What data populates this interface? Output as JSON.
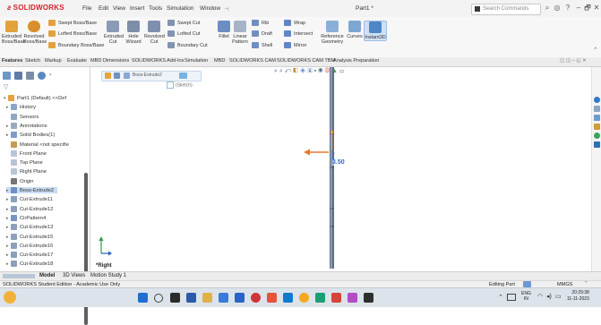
{
  "app": {
    "logo_text": "SOLIDWORKS",
    "doc_title": "Part1 *"
  },
  "menu": [
    "File",
    "Edit",
    "View",
    "Insert",
    "Tools",
    "Simulation",
    "Window"
  ],
  "search": {
    "placeholder": "Search Commands"
  },
  "window_controls": {
    "minimize": "–",
    "restore": "🗗",
    "close": "✕"
  },
  "ribbon": {
    "extruded_boss": "Extruded Boss/Base",
    "revolved_boss": "Revolved Boss/Base",
    "swept_boss": "Swept Boss/Base",
    "lofted_boss": "Lofted Boss/Base",
    "boundary_boss": "Boundary Boss/Base",
    "extruded_cut": "Extruded Cut",
    "hole_wizard": "Hole Wizard",
    "revolved_cut": "Revolved Cut",
    "swept_cut": "Swept Cut",
    "lofted_cut": "Lofted Cut",
    "boundary_cut": "Boundary Cut",
    "fillet": "Fillet",
    "linear_pattern": "Linear Pattern",
    "rib": "Rib",
    "draft": "Draft",
    "shell": "Shell",
    "wrap": "Wrap",
    "intersect": "Intersect",
    "mirror": "Mirror",
    "reference_geometry": "Reference Geometry",
    "curves": "Curves",
    "instant3d": "Instant3D"
  },
  "tabs": [
    "Features",
    "Sketch",
    "Markup",
    "Evaluate",
    "MBD Dimensions",
    "SOLIDWORKS Add-Ins",
    "Simulation",
    "MBD",
    "SOLIDWORKS CAM",
    "SOLIDWORKS CAM TBM",
    "Analysis Preparation"
  ],
  "tree": [
    {
      "label": "Part1 (Default) <<Def",
      "expand": "▾",
      "indent": 0
    },
    {
      "label": "History",
      "expand": "▸",
      "indent": 1
    },
    {
      "label": "Sensors",
      "expand": "",
      "indent": 1
    },
    {
      "label": "Annotations",
      "expand": "▸",
      "indent": 1
    },
    {
      "label": "Solid Bodies(1)",
      "expand": "▸",
      "indent": 1
    },
    {
      "label": "Material <not specifie",
      "expand": "",
      "indent": 1
    },
    {
      "label": "Front Plane",
      "expand": "",
      "indent": 1
    },
    {
      "label": "Top Plane",
      "expand": "",
      "indent": 1
    },
    {
      "label": "Right Plane",
      "expand": "",
      "indent": 1
    },
    {
      "label": "Origin",
      "expand": "",
      "indent": 1
    },
    {
      "label": "Boss-Extrude2",
      "expand": "▸",
      "indent": 1
    },
    {
      "label": "Cut-Extrude11",
      "expand": "▸",
      "indent": 1
    },
    {
      "label": "Cut-Extrude12",
      "expand": "▸",
      "indent": 1
    },
    {
      "label": "CirPattern4",
      "expand": "▸",
      "indent": 1
    },
    {
      "label": "Cut-Extrude13",
      "expand": "▸",
      "indent": 1
    },
    {
      "label": "Cut-Extrude15",
      "expand": "▸",
      "indent": 1
    },
    {
      "label": "Cut-Extrude16",
      "expand": "▸",
      "indent": 1
    },
    {
      "label": "Cut-Extrude17",
      "expand": "▸",
      "indent": 1
    },
    {
      "label": "Cut-Extrude18",
      "expand": "▸",
      "indent": 1
    }
  ],
  "breadcrumb": {
    "feature": "Boss-Extrude2",
    "sketch": "(Sketch)"
  },
  "canvas": {
    "dimension": "3.50",
    "view_label": "*Right"
  },
  "bottom_tabs": [
    "Model",
    "3D Views",
    "Motion Study 1"
  ],
  "status": {
    "left": "SOLIDWORKS Student Edition - Academic Use Only",
    "mode": "Editing Part",
    "units": "MMGS"
  },
  "taskbar": {
    "lang": "ENG",
    "region": "IN",
    "time": "20:29:38",
    "date": "11-11-2023"
  },
  "colors": {
    "brand_red": "#d2232a",
    "taskbar": "#dde3ea",
    "accent_blue": "#1f6fd1",
    "sketch_orange": "#f0a23b"
  }
}
